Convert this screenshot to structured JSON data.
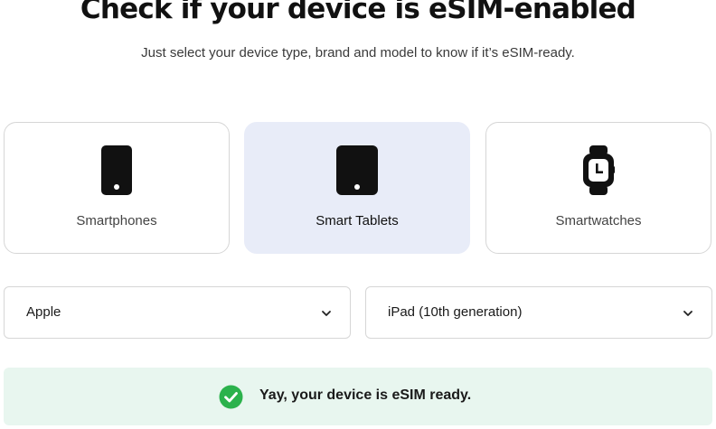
{
  "header": {
    "title": "Check if your device is eSIM-enabled",
    "subtitle": "Just select your device type, brand and model to know if it’s eSIM-ready."
  },
  "device_types": [
    {
      "label": "Smartphones",
      "icon": "smartphone-icon",
      "selected": false
    },
    {
      "label": "Smart Tablets",
      "icon": "tablet-icon",
      "selected": true
    },
    {
      "label": "Smartwatches",
      "icon": "smartwatch-icon",
      "selected": false
    }
  ],
  "brand_select": {
    "value": "Apple",
    "icon": "chevron-down-icon"
  },
  "model_select": {
    "value": "iPad (10th generation)",
    "icon": "chevron-down-icon"
  },
  "result": {
    "message": "Yay, your device is eSIM ready.",
    "icon": "check-circle-icon",
    "color": "#2bb24c",
    "background": "#e8f6ef"
  },
  "colors": {
    "selected_card_bg": "#e8ecf8",
    "border": "#d6d6d6",
    "icon": "#111111"
  }
}
